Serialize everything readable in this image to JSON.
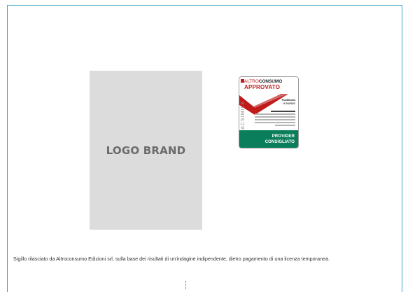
{
  "logo": {
    "placeholder_label": "LOGO BRAND"
  },
  "seal": {
    "brand_prefix": "ALTRO",
    "brand_suffix": "CONSUMO",
    "status": "APPROVATO",
    "side_label": "FACSIMILE",
    "pub_label": "Pubblicato",
    "pub_date": "il 03/2021",
    "footer_line1": "PROVIDER",
    "footer_line2": "CONSIGLIATO",
    "colors": {
      "red": "#c01a1a",
      "green": "#0a7d5a"
    }
  },
  "caption": {
    "text": "Sigillo rilasciato da Altroconsumo Edizioni srl, sulla base dei risultati di un'indagine indipendente, dietro pagamento di una licenza temporanea."
  },
  "frame": {
    "border_color": "#3fa6c9"
  }
}
